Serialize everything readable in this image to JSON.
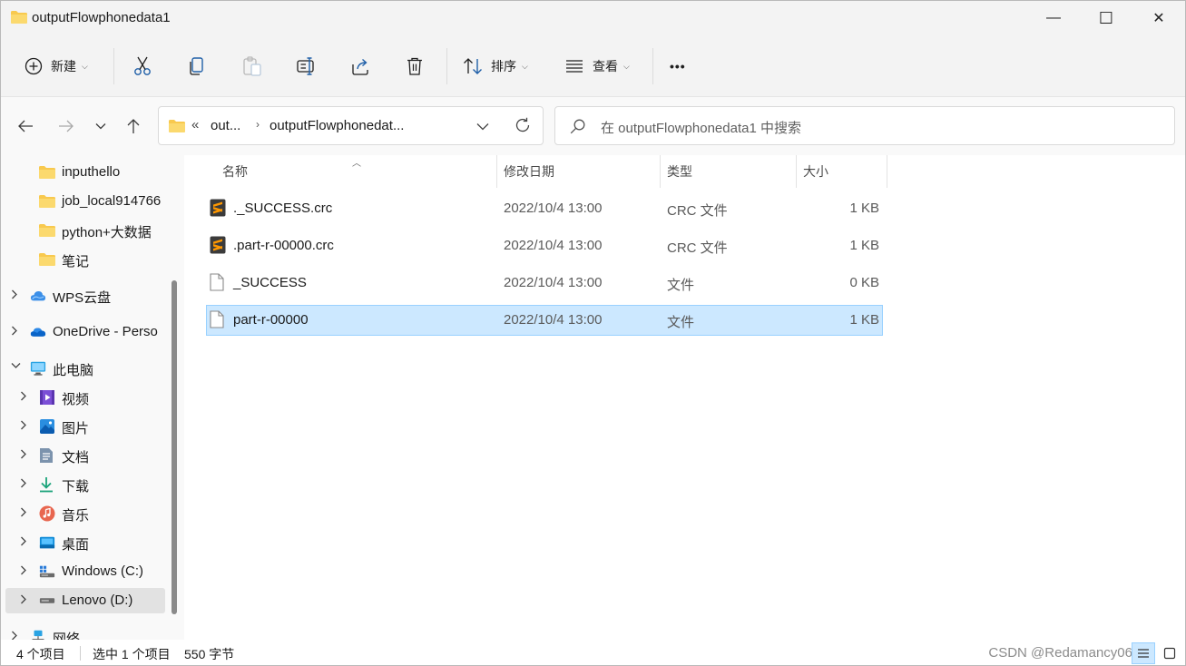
{
  "window": {
    "title": "outputFlowphonedata1",
    "controls": {
      "minimize": "—",
      "maximize": "☐",
      "close": "✕"
    }
  },
  "toolbar": {
    "new_label": "新建",
    "sort_label": "排序",
    "view_label": "查看",
    "more_label": "•••",
    "icons": [
      "plus-circle-icon",
      "cut-icon",
      "copy-icon",
      "paste-icon",
      "rename-icon",
      "share-icon",
      "delete-icon",
      "sort-icon",
      "view-icon",
      "more-icon"
    ]
  },
  "nav": {
    "breadcrumb_overflow": "«",
    "breadcrumb": [
      {
        "label": "out..."
      },
      {
        "label": "outputFlowphonedat..."
      }
    ],
    "breadcrumb_arrow": "›",
    "search_placeholder": "在 outputFlowphonedata1 中搜索"
  },
  "sidebar": {
    "items": [
      {
        "label": "inputhello",
        "icon": "folder-icon",
        "indent": 2,
        "expandable": false
      },
      {
        "label": "job_local914766",
        "icon": "folder-icon",
        "indent": 2,
        "expandable": false
      },
      {
        "label": "python+大数据",
        "icon": "folder-icon",
        "indent": 2,
        "expandable": false
      },
      {
        "label": "笔记",
        "icon": "folder-icon",
        "indent": 2,
        "expandable": false
      },
      {
        "label": "WPS云盘",
        "icon": "cloud-icon",
        "indent": 1,
        "expandable": true
      },
      {
        "label": "OneDrive - Perso",
        "icon": "onedrive-icon",
        "indent": 1,
        "expandable": true
      },
      {
        "label": "此电脑",
        "icon": "monitor-icon",
        "indent": 1,
        "expandable": true,
        "expanded": true
      },
      {
        "label": "视频",
        "icon": "video-icon",
        "indent": 2,
        "expandable": true
      },
      {
        "label": "图片",
        "icon": "picture-icon",
        "indent": 2,
        "expandable": true
      },
      {
        "label": "文档",
        "icon": "document-icon",
        "indent": 2,
        "expandable": true
      },
      {
        "label": "下载",
        "icon": "download-icon",
        "indent": 2,
        "expandable": true
      },
      {
        "label": "音乐",
        "icon": "music-icon",
        "indent": 2,
        "expandable": true
      },
      {
        "label": "桌面",
        "icon": "desktop-icon",
        "indent": 2,
        "expandable": true
      },
      {
        "label": "Windows (C:)",
        "icon": "windows-drive-icon",
        "indent": 2,
        "expandable": true
      },
      {
        "label": "Lenovo (D:)",
        "icon": "drive-icon",
        "indent": 2,
        "expandable": true,
        "selected": true
      },
      {
        "label": "网络",
        "icon": "network-icon",
        "indent": 1,
        "expandable": true
      }
    ]
  },
  "columns": {
    "name": "名称",
    "modified": "修改日期",
    "type": "类型",
    "size": "大小"
  },
  "files": [
    {
      "name": "._SUCCESS.crc",
      "modified": "2022/10/4 13:00",
      "type": "CRC 文件",
      "size": "1 KB",
      "icon": "sublime-file-icon",
      "selected": false
    },
    {
      "name": ".part-r-00000.crc",
      "modified": "2022/10/4 13:00",
      "type": "CRC 文件",
      "size": "1 KB",
      "icon": "sublime-file-icon",
      "selected": false
    },
    {
      "name": "_SUCCESS",
      "modified": "2022/10/4 13:00",
      "type": "文件",
      "size": "0 KB",
      "icon": "blank-file-icon",
      "selected": false
    },
    {
      "name": "part-r-00000",
      "modified": "2022/10/4 13:00",
      "type": "文件",
      "size": "1 KB",
      "icon": "blank-file-icon",
      "selected": true
    }
  ],
  "status": {
    "item_count": "4 个项目",
    "selection": "选中 1 个项目",
    "selection_size": "550 字节",
    "watermark": "CSDN @Redamancy06"
  },
  "colors": {
    "accent": "#0067c0",
    "selected_bg": "#cce8ff",
    "selected_border": "#99d1ff",
    "folder": "#f8c94e"
  }
}
